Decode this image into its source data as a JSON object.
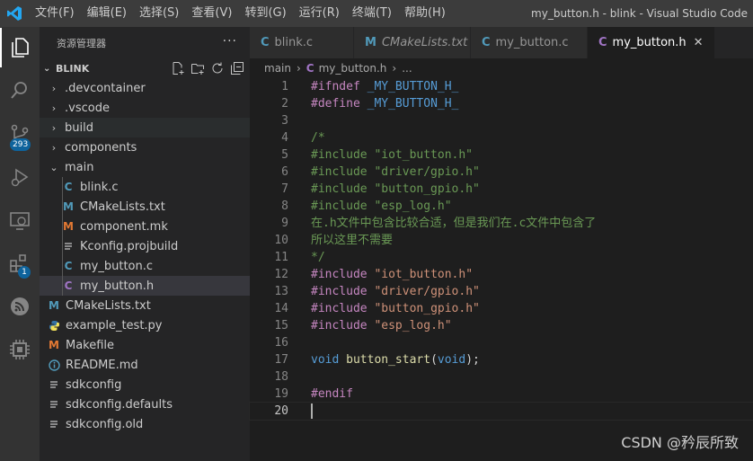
{
  "window": {
    "title": "my_button.h - blink - Visual Studio Code",
    "menu": [
      "文件(F)",
      "编辑(E)",
      "选择(S)",
      "查看(V)",
      "转到(G)",
      "运行(R)",
      "终端(T)",
      "帮助(H)"
    ]
  },
  "activity_bar": {
    "items": [
      {
        "name": "explorer",
        "icon": "files-icon",
        "active": true
      },
      {
        "name": "search",
        "icon": "search-icon"
      },
      {
        "name": "source-control",
        "icon": "source-control-icon",
        "badge": "293"
      },
      {
        "name": "run-debug",
        "icon": "run-debug-icon"
      },
      {
        "name": "remote-explorer",
        "icon": "remote-explorer-icon"
      },
      {
        "name": "extensions",
        "icon": "extensions-icon",
        "badge": "1"
      },
      {
        "name": "esp-idf",
        "icon": "esp-idf-icon"
      },
      {
        "name": "platform",
        "icon": "chip-icon"
      }
    ]
  },
  "sidebar": {
    "title": "资源管理器",
    "more": "···",
    "section": "BLINK",
    "tree": [
      {
        "label": ".devcontainer",
        "kind": "folder-closed",
        "depth": 1
      },
      {
        "label": ".vscode",
        "kind": "folder-closed",
        "depth": 1
      },
      {
        "label": "build",
        "kind": "folder-closed",
        "depth": 1,
        "hover": true
      },
      {
        "label": "components",
        "kind": "folder-closed",
        "depth": 1
      },
      {
        "label": "main",
        "kind": "folder-open",
        "depth": 1
      },
      {
        "label": "blink.c",
        "kind": "c",
        "depth": 2
      },
      {
        "label": "CMakeLists.txt",
        "kind": "cmake",
        "depth": 2
      },
      {
        "label": "component.mk",
        "kind": "make",
        "depth": 2
      },
      {
        "label": "Kconfig.projbuild",
        "kind": "text",
        "depth": 2
      },
      {
        "label": "my_button.c",
        "kind": "c",
        "depth": 2
      },
      {
        "label": "my_button.h",
        "kind": "h",
        "depth": 2,
        "selected": true
      },
      {
        "label": "CMakeLists.txt",
        "kind": "cmake",
        "depth": 1
      },
      {
        "label": "example_test.py",
        "kind": "python",
        "depth": 1
      },
      {
        "label": "Makefile",
        "kind": "make",
        "depth": 1
      },
      {
        "label": "README.md",
        "kind": "info",
        "depth": 1
      },
      {
        "label": "sdkconfig",
        "kind": "text",
        "depth": 1
      },
      {
        "label": "sdkconfig.defaults",
        "kind": "text",
        "depth": 1
      },
      {
        "label": "sdkconfig.old",
        "kind": "text",
        "depth": 1
      }
    ]
  },
  "tabs": [
    {
      "label": "blink.c",
      "icon": "C",
      "icon_color": "#519aba"
    },
    {
      "label": "CMakeLists.txt",
      "icon": "M",
      "icon_color": "#519aba",
      "italic": true
    },
    {
      "label": "my_button.c",
      "icon": "C",
      "icon_color": "#519aba"
    },
    {
      "label": "my_button.h",
      "icon": "C",
      "icon_color": "#a074c4",
      "active": true,
      "close": "✕"
    }
  ],
  "breadcrumbs": {
    "folder": "main",
    "file": "my_button.h",
    "symbol": "..."
  },
  "code": {
    "current_line": 20,
    "lines": [
      [
        {
          "t": "#ifndef ",
          "c": "#c586c0"
        },
        {
          "t": "_MY_BUTTON_H_",
          "c": "#569cd6"
        }
      ],
      [
        {
          "t": "#define ",
          "c": "#c586c0"
        },
        {
          "t": "_MY_BUTTON_H_",
          "c": "#569cd6"
        }
      ],
      [],
      [
        {
          "t": "/*",
          "c": "#6a9955"
        }
      ],
      [
        {
          "t": "#include \"iot_button.h\"",
          "c": "#6a9955"
        }
      ],
      [
        {
          "t": "#include \"driver/gpio.h\"",
          "c": "#6a9955"
        }
      ],
      [
        {
          "t": "#include \"button_gpio.h\"",
          "c": "#6a9955"
        }
      ],
      [
        {
          "t": "#include \"esp_log.h\"",
          "c": "#6a9955"
        }
      ],
      [
        {
          "t": "在.h文件中包含比较合适，但是我们在.c文件中包含了",
          "c": "#6a9955"
        }
      ],
      [
        {
          "t": "所以这里不需要",
          "c": "#6a9955"
        }
      ],
      [
        {
          "t": "*/",
          "c": "#6a9955"
        }
      ],
      [
        {
          "t": "#include ",
          "c": "#c586c0"
        },
        {
          "t": "\"iot_button.h\"",
          "c": "#ce9178"
        }
      ],
      [
        {
          "t": "#include ",
          "c": "#c586c0"
        },
        {
          "t": "\"driver/gpio.h\"",
          "c": "#ce9178"
        }
      ],
      [
        {
          "t": "#include ",
          "c": "#c586c0"
        },
        {
          "t": "\"button_gpio.h\"",
          "c": "#ce9178"
        }
      ],
      [
        {
          "t": "#include ",
          "c": "#c586c0"
        },
        {
          "t": "\"esp_log.h\"",
          "c": "#ce9178"
        }
      ],
      [],
      [
        {
          "t": "void ",
          "c": "#569cd6"
        },
        {
          "t": "button_start",
          "c": "#dcdcaa"
        },
        {
          "t": "(",
          "c": "#d4d4d4"
        },
        {
          "t": "void",
          "c": "#569cd6"
        },
        {
          "t": ");",
          "c": "#d4d4d4"
        }
      ],
      [],
      [
        {
          "t": "#endif",
          "c": "#c586c0"
        }
      ],
      []
    ]
  },
  "watermark": "CSDN @矜辰所致"
}
